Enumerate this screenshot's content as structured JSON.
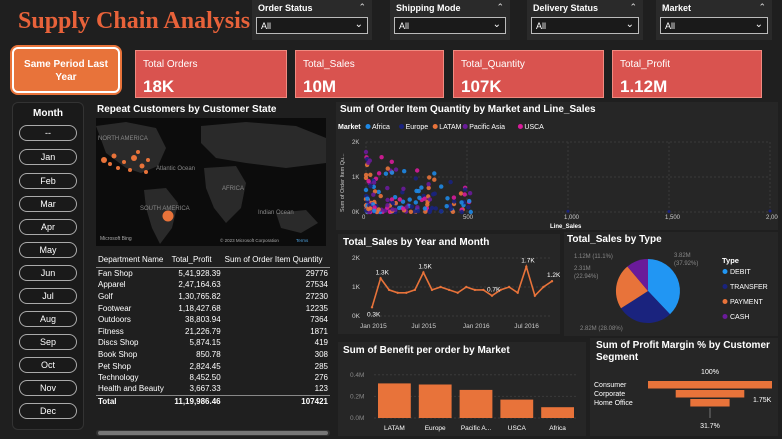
{
  "title": "Supply Chain Analysis",
  "slicers": [
    {
      "label": "Order Status",
      "value": "All"
    },
    {
      "label": "Shipping Mode",
      "value": "All"
    },
    {
      "label": "Delivery Status",
      "value": "All"
    },
    {
      "label": "Market",
      "value": "All"
    }
  ],
  "spl_button": "Same Period Last Year",
  "kpis": [
    {
      "label": "Total Orders",
      "value": "18K"
    },
    {
      "label": "Total_Sales",
      "value": "10M"
    },
    {
      "label": "Total_Quantity",
      "value": "107K"
    },
    {
      "label": "Total_Profit",
      "value": "1.12M"
    }
  ],
  "month_slicer": {
    "title": "Month",
    "items": [
      "--",
      "Jan",
      "Feb",
      "Mar",
      "Apr",
      "May",
      "Jun",
      "Jul",
      "Aug",
      "Sep",
      "Oct",
      "Nov",
      "Dec"
    ]
  },
  "map": {
    "title": "Repeat Customers by Customer State",
    "labels": [
      "NORTH AMERICA",
      "Atlantic Ocean",
      "AFRICA",
      "SOUTH AMERICA",
      "Indian Ocean"
    ],
    "attribution": "© 2023 Microsoft Corporation",
    "terms": "Terms",
    "logo": "Microsoft Bing"
  },
  "table": {
    "headers": [
      "Department Name",
      "Total_Profit",
      "Sum of Order Item Quantity"
    ],
    "rows": [
      [
        "Fan Shop",
        "5,41,928.39",
        "29776"
      ],
      [
        "Apparel",
        "2,47,164.63",
        "27534"
      ],
      [
        "Golf",
        "1,30,765.82",
        "27230"
      ],
      [
        "Footwear",
        "1,18,427.68",
        "12235"
      ],
      [
        "Outdoors",
        "38,803.94",
        "7364"
      ],
      [
        "Fitness",
        "21,226.79",
        "1871"
      ],
      [
        "Discs Shop",
        "5,874.15",
        "419"
      ],
      [
        "Book Shop",
        "850.78",
        "308"
      ],
      [
        "Pet Shop",
        "2,824.45",
        "285"
      ],
      [
        "Technology",
        "8,452.50",
        "276"
      ],
      [
        "Health and Beauty",
        "3,667.33",
        "123"
      ]
    ],
    "total": [
      "Total",
      "11,19,986.46",
      "107421"
    ]
  },
  "scatter": {
    "title": "Sum of Order Item Quantity by Market and Line_Sales",
    "legend_title": "Market",
    "legend": [
      {
        "name": "Africa",
        "color": "#1e88e5"
      },
      {
        "name": "Europe",
        "color": "#1a237e"
      },
      {
        "name": "LATAM",
        "color": "#e8733a"
      },
      {
        "name": "Pacific Asia",
        "color": "#6a1b9a"
      },
      {
        "name": "USCA",
        "color": "#d81b9a"
      }
    ],
    "ylabel": "Sum of Order Item Qu...",
    "xlabel": "Line_Sales",
    "yticks": [
      "0K",
      "1K",
      "2K"
    ],
    "xticks": [
      "0",
      "500",
      "1,000",
      "1,500",
      "2,000"
    ]
  },
  "chart_data": [
    {
      "type": "line",
      "title": "Total_Sales by Year and Month",
      "x": [
        "Jan 2015",
        "Feb 2015",
        "Mar 2015",
        "Apr 2015",
        "May 2015",
        "Jun 2015",
        "Jul 2015",
        "Aug 2015",
        "Sep 2015",
        "Oct 2015",
        "Nov 2015",
        "Dec 2015",
        "Jan 2016",
        "Feb 2016",
        "Mar 2016",
        "Apr 2016",
        "May 2016",
        "Jun 2016",
        "Jul 2016",
        "Aug 2016",
        "Sep 2016",
        "Oct 2016"
      ],
      "values": [
        0.3,
        1.3,
        0.9,
        0.8,
        0.8,
        0.9,
        1.5,
        0.9,
        1.0,
        0.9,
        0.8,
        1.0,
        0.9,
        0.9,
        0.7,
        0.9,
        1.0,
        0.8,
        1.7,
        0.7,
        1.0,
        1.2
      ],
      "point_labels": {
        "0": "0.3K",
        "1": "1.3K",
        "6": "1.5K",
        "14": "0.7K",
        "18": "1.7K",
        "21": "1.2K"
      },
      "yticks": [
        "0K",
        "1K",
        "2K"
      ],
      "xticks": [
        "Jan 2015",
        "Jul 2015",
        "Jan 2016",
        "Jul 2016"
      ],
      "ylim": [
        0,
        2
      ]
    },
    {
      "type": "pie",
      "title": "Total_Sales by Type",
      "legend_title": "Type",
      "slices": [
        {
          "name": "DEBIT",
          "value": 3.82,
          "pct": "37.92%",
          "label": "3.82M (37.92%)",
          "color": "#2196f3"
        },
        {
          "name": "TRANSFER",
          "value": 2.82,
          "pct": "28.08%",
          "label": "2.82M (28.08%)",
          "color": "#1a237e"
        },
        {
          "name": "PAYMENT",
          "value": 2.31,
          "pct": "22.94%",
          "label": "2.31M (22.94%)",
          "color": "#e8733a"
        },
        {
          "name": "CASH",
          "value": 1.12,
          "pct": "11.1%",
          "label": "1.12M (11.1%)",
          "color": "#6a1b9a"
        }
      ]
    },
    {
      "type": "bar",
      "title": "Sum of Benefit per order by Market",
      "categories": [
        "LATAM",
        "Europe",
        "Pacific A...",
        "USCA",
        "Africa"
      ],
      "values": [
        0.32,
        0.31,
        0.26,
        0.17,
        0.1
      ],
      "yticks": [
        "0.0M",
        "0.2M",
        "0.4M"
      ],
      "ylim": [
        0,
        0.5
      ],
      "color": "#e8733a"
    },
    {
      "type": "bar",
      "title": "Sum of Profit Margin % by Customer Segment",
      "categories": [
        "Consumer",
        "Corporate",
        "Home Office"
      ],
      "values": [
        100,
        55.3,
        31.7
      ],
      "top_label": "100%",
      "side_label": "1.75K",
      "bottom_label": "31.7%",
      "color": "#e8733a"
    }
  ]
}
